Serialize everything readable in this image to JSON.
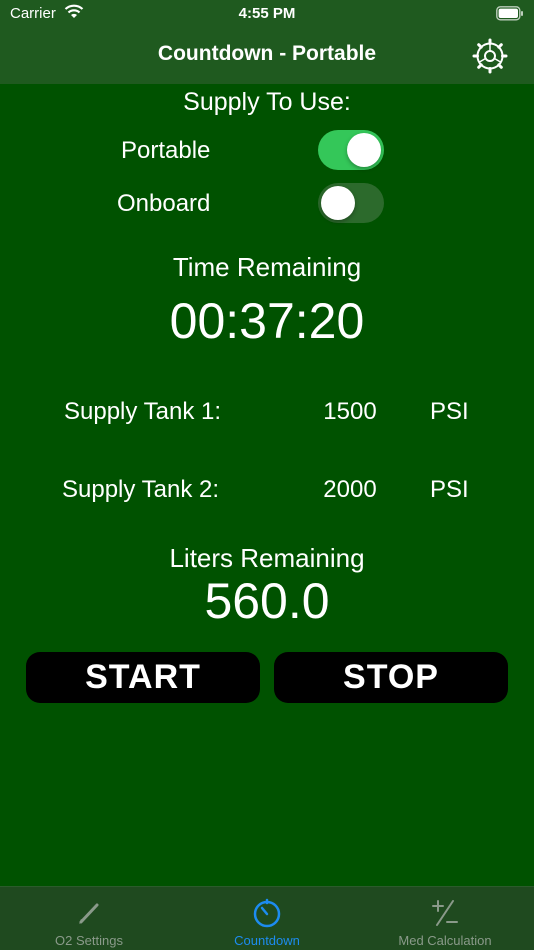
{
  "status": {
    "carrier": "Carrier",
    "time": "4:55 PM"
  },
  "nav": {
    "title": "Countdown - Portable",
    "settings_icon": "gear-icon"
  },
  "supply": {
    "label": "Supply To Use:",
    "options": [
      {
        "label": "Portable",
        "on": true
      },
      {
        "label": "Onboard",
        "on": false
      }
    ]
  },
  "time": {
    "label": "Time Remaining",
    "value": "00:37:20"
  },
  "tanks": [
    {
      "label": "Supply Tank 1:",
      "value": "1500",
      "unit": "PSI"
    },
    {
      "label": "Supply Tank 2:",
      "value": "2000",
      "unit": "PSI"
    }
  ],
  "liters": {
    "label": "Liters Remaining",
    "value": "560.0"
  },
  "actions": {
    "start_label": "START",
    "stop_label": "STOP"
  },
  "tabs": [
    {
      "label": "O2 Settings",
      "icon": "pencil-icon",
      "active": false
    },
    {
      "label": "Countdown",
      "icon": "timer-icon",
      "active": true
    },
    {
      "label": "Med Calculation",
      "icon": "plus-minus-icon",
      "active": false
    }
  ],
  "colors": {
    "background": "#005200",
    "bar": "#1f5a1f",
    "toggle_on": "#34c759",
    "active_tab": "#1d8cf0"
  }
}
